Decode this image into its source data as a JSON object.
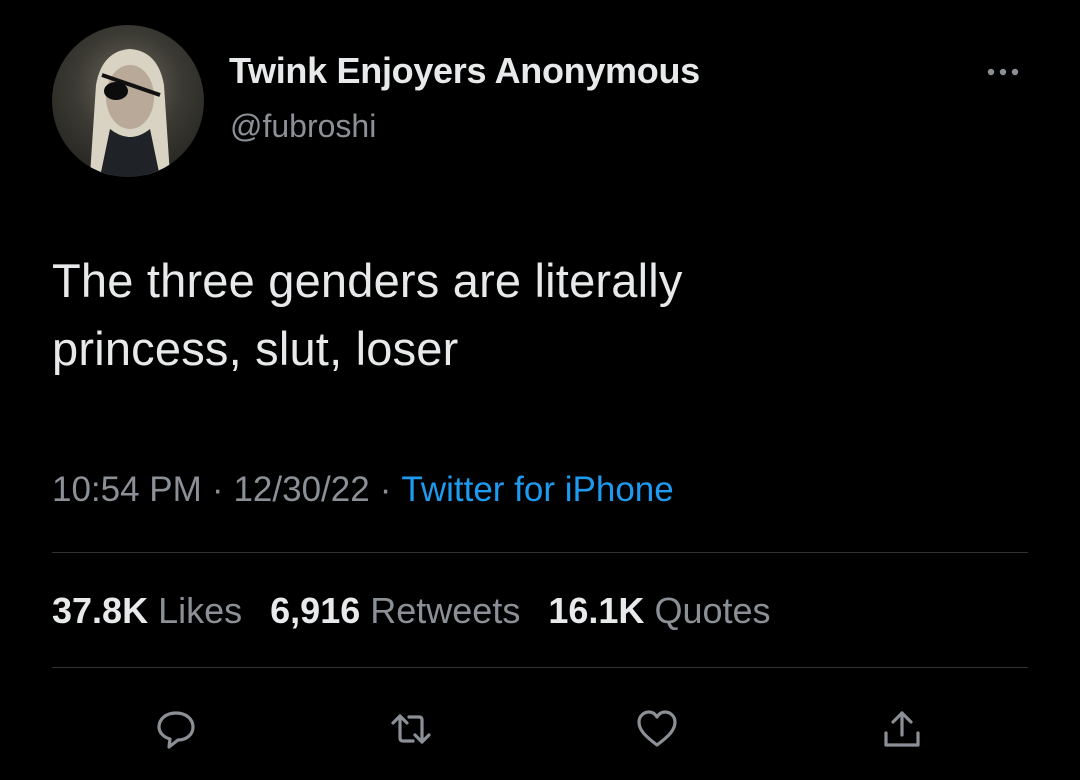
{
  "tweet": {
    "display_name": "Twink Enjoyers Anonymous",
    "handle": "@fubroshi",
    "text_lines": [
      "The three genders are literally",
      "princess, slut, loser"
    ],
    "time": "10:54 PM",
    "date": "12/30/22",
    "separator": "·",
    "source": "Twitter for iPhone",
    "stats": {
      "likes_count": "37.8K",
      "likes_label": "Likes",
      "retweets_count": "6,916",
      "retweets_label": "Retweets",
      "quotes_count": "16.1K",
      "quotes_label": "Quotes"
    }
  },
  "icons": {
    "more": "more-icon",
    "reply": "reply-icon",
    "retweet": "retweet-icon",
    "like": "heart-icon",
    "share": "share-icon"
  },
  "colors": {
    "background": "#000000",
    "text_primary": "#e7e9ea",
    "text_secondary": "#8b9096",
    "link": "#1d9bf0",
    "divider": "#2f3336"
  }
}
